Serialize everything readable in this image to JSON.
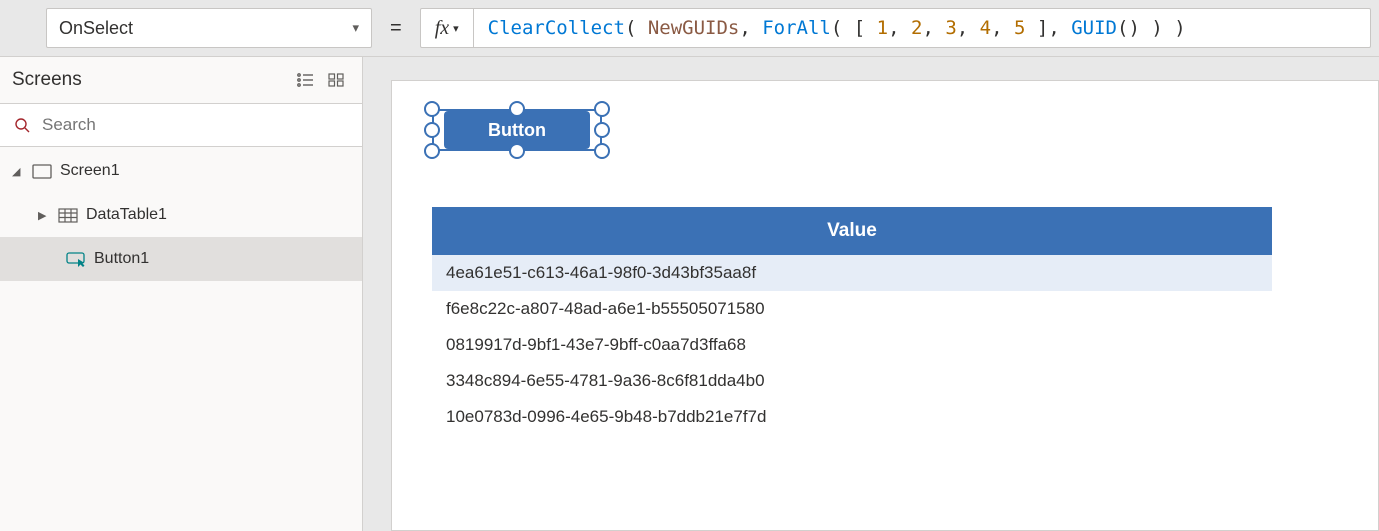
{
  "property_selector": {
    "value": "OnSelect"
  },
  "formula": {
    "tokens": [
      {
        "t": "ClearCollect",
        "c": "tok-fn"
      },
      {
        "t": "( ",
        "c": "tok-punc"
      },
      {
        "t": "NewGUIDs",
        "c": "tok-var"
      },
      {
        "t": ", ",
        "c": "tok-punc"
      },
      {
        "t": "ForAll",
        "c": "tok-fn"
      },
      {
        "t": "( [ ",
        "c": "tok-punc"
      },
      {
        "t": "1",
        "c": "tok-num"
      },
      {
        "t": ", ",
        "c": "tok-punc"
      },
      {
        "t": "2",
        "c": "tok-num"
      },
      {
        "t": ", ",
        "c": "tok-punc"
      },
      {
        "t": "3",
        "c": "tok-num"
      },
      {
        "t": ", ",
        "c": "tok-punc"
      },
      {
        "t": "4",
        "c": "tok-num"
      },
      {
        "t": ", ",
        "c": "tok-punc"
      },
      {
        "t": "5",
        "c": "tok-num"
      },
      {
        "t": " ], ",
        "c": "tok-punc"
      },
      {
        "t": "GUID",
        "c": "tok-fn"
      },
      {
        "t": "() ) )",
        "c": "tok-punc"
      }
    ]
  },
  "screens_panel": {
    "title": "Screens",
    "search_placeholder": "Search",
    "tree": {
      "root": "Screen1",
      "children": [
        {
          "name": "DataTable1",
          "icon": "table"
        },
        {
          "name": "Button1",
          "icon": "button",
          "selected": true
        }
      ]
    }
  },
  "canvas": {
    "button_label": "Button",
    "table": {
      "header": "Value",
      "rows": [
        "4ea61e51-c613-46a1-98f0-3d43bf35aa8f",
        "f6e8c22c-a807-48ad-a6e1-b55505071580",
        "0819917d-9bf1-43e7-9bff-c0aa7d3ffa68",
        "3348c894-6e55-4781-9a36-8c6f81dda4b0",
        "10e0783d-0996-4e65-9b48-b7ddb21e7f7d"
      ]
    }
  }
}
